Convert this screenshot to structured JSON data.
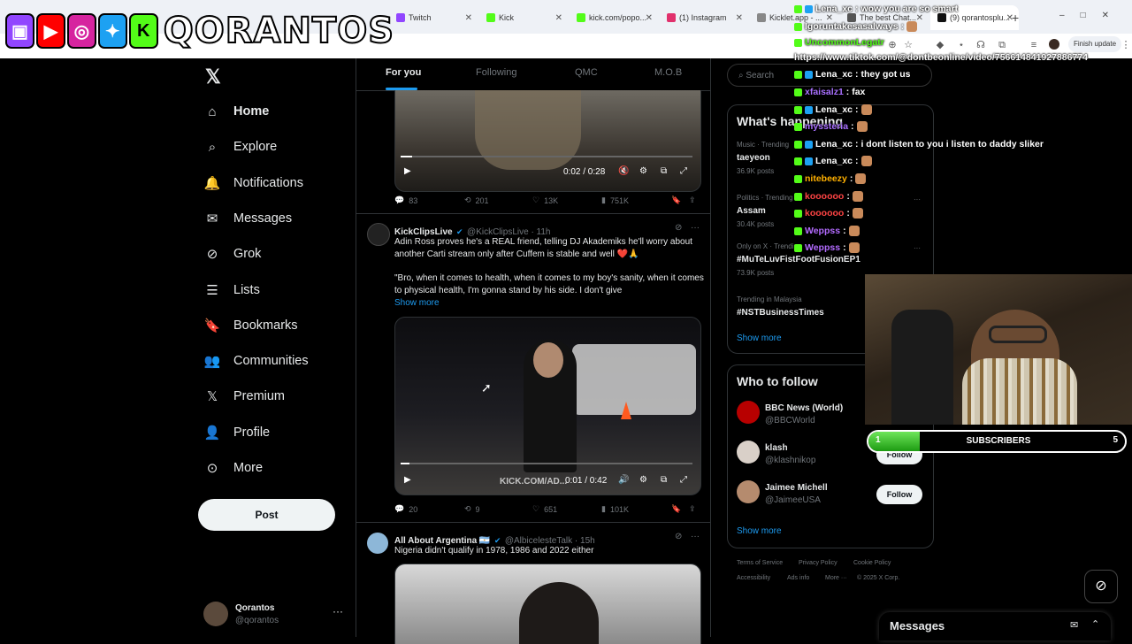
{
  "browser": {
    "tabs": [
      {
        "title": "Twitch",
        "color": "#9146ff"
      },
      {
        "title": "Kick",
        "color": "#53fc18"
      },
      {
        "title": "kick.com/popo...",
        "color": "#53fc18"
      },
      {
        "title": "(1) Instagram",
        "color": "#e1306c"
      },
      {
        "title": "Kicklet.app - ...",
        "color": "#888888"
      },
      {
        "title": "The best Chat...",
        "color": "#555555"
      },
      {
        "title": "(9) qorantosplu...",
        "color": "#111111"
      }
    ],
    "finish_update": "Finish update"
  },
  "overlay_logo": {
    "text": "QORANTOS"
  },
  "nav": {
    "items": [
      {
        "label": "Home",
        "icon": "home-icon"
      },
      {
        "label": "Explore",
        "icon": "search-icon"
      },
      {
        "label": "Notifications",
        "icon": "bell-icon"
      },
      {
        "label": "Messages",
        "icon": "mail-icon"
      },
      {
        "label": "Grok",
        "icon": "grok-icon"
      },
      {
        "label": "Lists",
        "icon": "list-icon"
      },
      {
        "label": "Bookmarks",
        "icon": "bookmark-icon"
      },
      {
        "label": "Communities",
        "icon": "communities-icon"
      },
      {
        "label": "Premium",
        "icon": "x-icon"
      },
      {
        "label": "Profile",
        "icon": "profile-icon"
      },
      {
        "label": "More",
        "icon": "more-icon"
      }
    ],
    "post": "Post",
    "user_name": "Qorantos",
    "user_handle": "@qorantos"
  },
  "timeline": {
    "tabs": [
      "For you",
      "Following",
      "QMC",
      "M.O.B"
    ],
    "post1": {
      "time": "0:02 / 0:28",
      "replies": "83",
      "reposts": "201",
      "likes": "13K",
      "views": "751K"
    },
    "post2": {
      "name": "KickClipsLive",
      "handle": "@KickClipsLive · 11h",
      "text1": "Adin Ross proves he's a REAL friend, telling DJ Akademiks he'll worry about another Carti stream only after Cuffem is stable and well ❤️🙏",
      "text2": "\"Bro, when it comes to health, when it comes to my boy's sanity, when it comes to physical health, I'm gonna stand by his side. I don't give",
      "show_more": "Show more",
      "watermark": "KICK.COM/AD...",
      "time": "0:01 / 0:42",
      "replies": "20",
      "reposts": "9",
      "likes": "651",
      "views": "101K"
    },
    "post3": {
      "name": "All About Argentina 🇦🇷",
      "handle": "@AlbicelesteTalk · 15h",
      "text": "Nigeria didn't qualify in 1978, 1986 and 2022 either"
    }
  },
  "right": {
    "search_placeholder": "Search",
    "happening_title": "What's happening",
    "trends": [
      {
        "meta": "Music · Trending",
        "name": "taeyeon",
        "count": "36.9K posts"
      },
      {
        "meta": "Politics · Trending",
        "name": "Assam",
        "count": "30.4K posts"
      },
      {
        "meta": "Only on X · Trending",
        "name": "#MuTeLuvFistFootFusionEP1",
        "count": "73.9K posts"
      },
      {
        "meta": "Trending in Malaysia",
        "name": "#NSTBusinessTimes",
        "count": ""
      }
    ],
    "show_more": "Show more",
    "who_title": "Who to follow",
    "who": [
      {
        "name": "BBC News (World)",
        "handle": "@BBCWorld",
        "button": "Follow"
      },
      {
        "name": "klash",
        "handle": "@klashnikop",
        "button": "Follow"
      },
      {
        "name": "Jaimee Michell",
        "handle": "@JaimeeUSA",
        "button": "Follow"
      }
    ],
    "who_show_more": "Show more",
    "footer": [
      "Terms of Service",
      "Privacy Policy",
      "Cookie Policy",
      "Accessibility",
      "Ads info",
      "More ···",
      "© 2025 X Corp."
    ],
    "messages": "Messages"
  },
  "chat": {
    "messages": [
      {
        "user": "Lena_xc",
        "text": ": wow you are so smart",
        "color": "#ffffff"
      },
      {
        "user": "Igoruntakesasalways",
        "text": ":",
        "color": "#ffffff"
      },
      {
        "user": "UncommonLegatr",
        "text": "",
        "color": "#53fc18"
      },
      {
        "user": "",
        "text": "https://www.tiktok.com/@dontbeonline/video/756614841927886774",
        "color": "#ffffff"
      },
      {
        "user": "Lena_xc",
        "text": ": they got us",
        "color": "#ffffff"
      },
      {
        "user": "xfaisalz1",
        "text": ": fax",
        "color": "#a970ff"
      },
      {
        "user": "Lena_xc",
        "text": ":",
        "color": "#ffffff"
      },
      {
        "user": "myssteria",
        "text": ":",
        "color": "#a970ff"
      },
      {
        "user": "Lena_xc",
        "text": ": i dont listen to you i listen to daddy sliker",
        "color": "#ffffff"
      },
      {
        "user": "Lena_xc",
        "text": ":",
        "color": "#ffffff"
      },
      {
        "user": "nitebeezy",
        "text": ":",
        "color": "#ffb000"
      },
      {
        "user": "koooooo",
        "text": ":",
        "color": "#ff4444"
      },
      {
        "user": "koooooo",
        "text": ":",
        "color": "#ff4444"
      },
      {
        "user": "Weppss",
        "text": ":",
        "color": "#b36bff"
      },
      {
        "user": "Weppss",
        "text": ":",
        "color": "#b36bff"
      }
    ]
  },
  "subs": {
    "left": "1",
    "label": "SUBSCRIBERS",
    "right": "5",
    "fill_fraction": 0.2
  }
}
